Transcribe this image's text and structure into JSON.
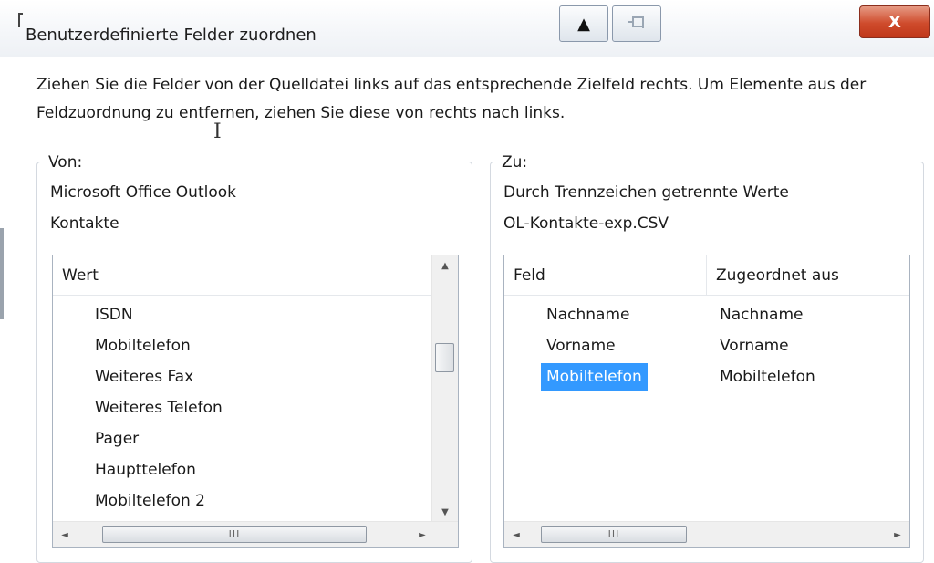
{
  "window": {
    "title": "Benutzerdefinierte Felder zuordnen",
    "nav_up_icon": "triangle-up-icon",
    "pin_icon": "pin-icon",
    "close_label": "X"
  },
  "intro": {
    "text": "Ziehen Sie die Felder von der Quelldatei links auf das entsprechende Zielfeld rechts. Um Elemente aus der Feldzuordnung zu entfernen, ziehen Sie diese von rechts nach links."
  },
  "from": {
    "legend": "Von:",
    "line1": "Microsoft Office Outlook",
    "line2": "Kontakte",
    "column_header": "Wert",
    "items": [
      "ISDN",
      "Mobiltelefon",
      "Weiteres Fax",
      "Weiteres Telefon",
      "Pager",
      "Haupttelefon",
      "Mobiltelefon 2"
    ]
  },
  "to": {
    "legend": "Zu:",
    "line1": "Durch Trennzeichen getrennte Werte",
    "line2": "OL-Kontakte-exp.CSV",
    "columns": [
      "Feld",
      "Zugeordnet aus"
    ],
    "rows": [
      {
        "feld": "Nachname",
        "aus": "Nachname",
        "selected": false
      },
      {
        "feld": "Vorname",
        "aus": "Vorname",
        "selected": false
      },
      {
        "feld": "Mobiltelefon",
        "aus": "Mobiltelefon",
        "selected": true
      }
    ]
  },
  "scrollbar": {
    "up": "▲",
    "down": "▼",
    "left": "◄",
    "right": "►",
    "grip": "III"
  },
  "colors": {
    "selection": "#3399ff",
    "close_button": "#c7422a"
  }
}
